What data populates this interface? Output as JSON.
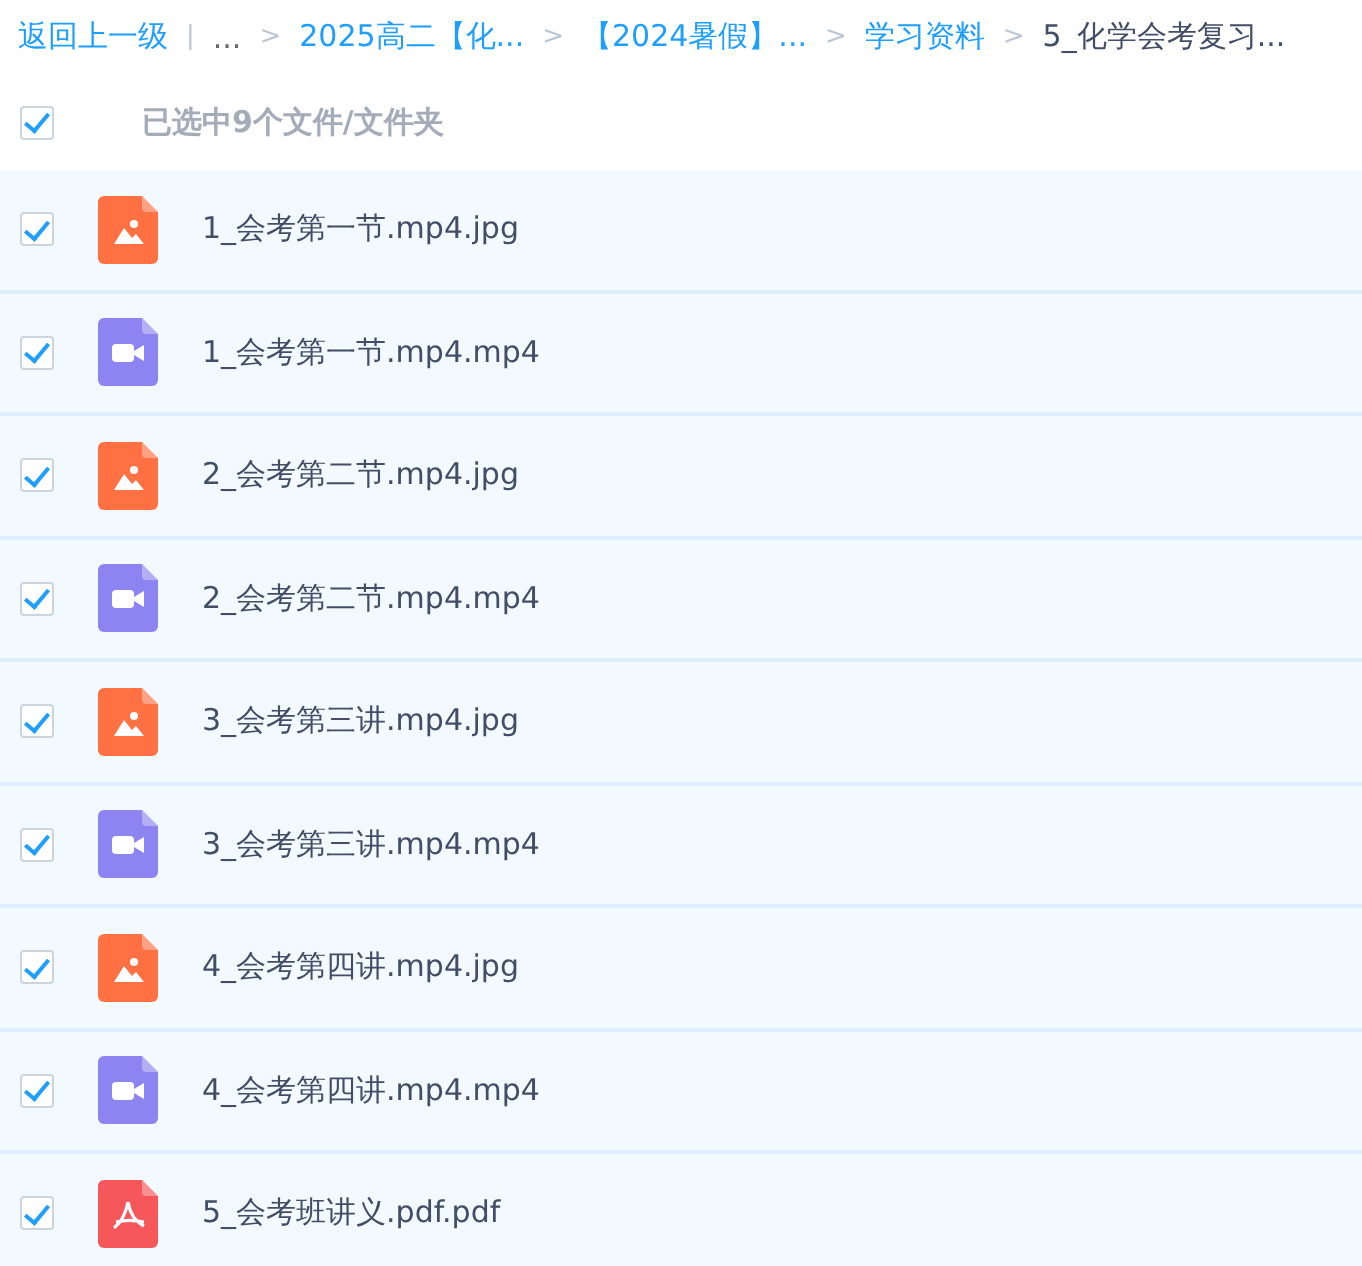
{
  "breadcrumb": [
    {
      "kind": "link",
      "text": "返回上一级"
    },
    {
      "kind": "sep",
      "text": "|"
    },
    {
      "kind": "muted",
      "text": "..."
    },
    {
      "kind": "sep",
      "text": ">"
    },
    {
      "kind": "link",
      "text": "2025高二【化..."
    },
    {
      "kind": "sep",
      "text": ">"
    },
    {
      "kind": "link",
      "text": "【2024暑假】..."
    },
    {
      "kind": "sep",
      "text": ">"
    },
    {
      "kind": "link",
      "text": "学习资料"
    },
    {
      "kind": "sep",
      "text": ">"
    },
    {
      "kind": "current",
      "text": "5_化学会考复习..."
    }
  ],
  "select_all": {
    "checked": true,
    "label": "已选中9个文件/文件夹"
  },
  "files": [
    {
      "kind": "image",
      "name": "1_会考第一节.mp4.jpg",
      "checked": true
    },
    {
      "kind": "video",
      "name": "1_会考第一节.mp4.mp4",
      "checked": true
    },
    {
      "kind": "image",
      "name": "2_会考第二节.mp4.jpg",
      "checked": true
    },
    {
      "kind": "video",
      "name": "2_会考第二节.mp4.mp4",
      "checked": true
    },
    {
      "kind": "image",
      "name": "3_会考第三讲.mp4.jpg",
      "checked": true
    },
    {
      "kind": "video",
      "name": "3_会考第三讲.mp4.mp4",
      "checked": true
    },
    {
      "kind": "image",
      "name": "4_会考第四讲.mp4.jpg",
      "checked": true
    },
    {
      "kind": "video",
      "name": "4_会考第四讲.mp4.mp4",
      "checked": true
    },
    {
      "kind": "pdf",
      "name": "5_会考班讲义.pdf.pdf",
      "checked": true
    }
  ]
}
